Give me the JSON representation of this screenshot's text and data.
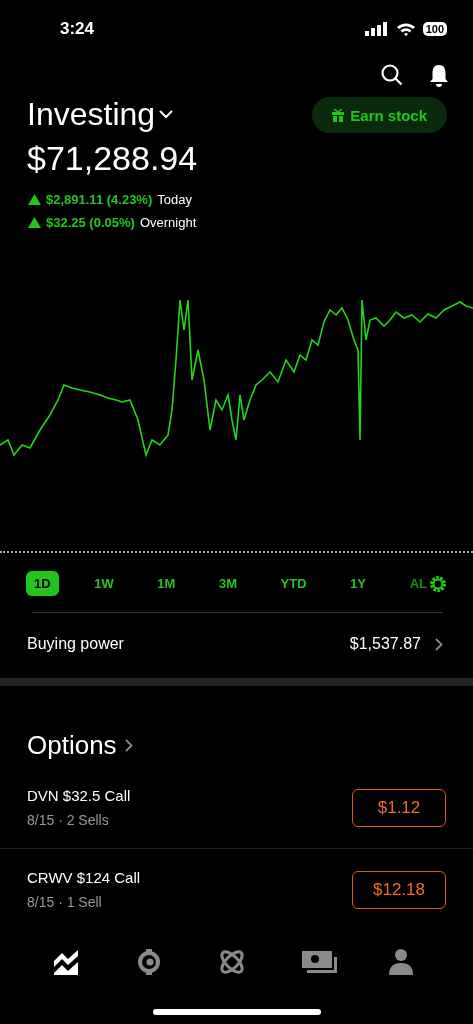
{
  "status_bar": {
    "time": "3:24",
    "battery": "100"
  },
  "header": {
    "title": "Investing",
    "earn_button": "Earn stock",
    "value": "$71,288.94",
    "changes": [
      {
        "amount": "$2,891.11 (4.23%)",
        "label": "Today"
      },
      {
        "amount": "$32.25 (0.05%)",
        "label": "Overnight"
      }
    ]
  },
  "ranges": [
    {
      "label": "1D",
      "selected": true
    },
    {
      "label": "1W",
      "selected": false
    },
    {
      "label": "1M",
      "selected": false
    },
    {
      "label": "3M",
      "selected": false
    },
    {
      "label": "YTD",
      "selected": false
    },
    {
      "label": "1Y",
      "selected": false
    },
    {
      "label": "AL",
      "selected": false
    }
  ],
  "buying_power": {
    "label": "Buying power",
    "value": "$1,537.87"
  },
  "options": {
    "title": "Options",
    "rows": [
      {
        "name": "DVN $32.5 Call",
        "detail": "8/15 · 2 Sells",
        "price": "$1.12"
      },
      {
        "name": "CRWV $124 Call",
        "detail": "8/15 · 1 Sell",
        "price": "$12.18"
      }
    ]
  },
  "nav": [
    {
      "kind": "chart",
      "selected": true
    },
    {
      "kind": "coin",
      "selected": false
    },
    {
      "kind": "orbit",
      "selected": false
    },
    {
      "kind": "cash",
      "selected": false
    },
    {
      "kind": "person",
      "selected": false
    }
  ]
}
